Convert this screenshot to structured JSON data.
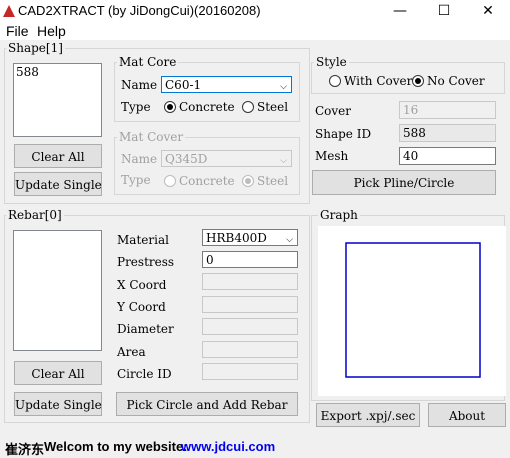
{
  "window": {
    "title": "CAD2XTRACT (by JiDongCui)(20160208)",
    "minimize": "—",
    "maximize": "☐",
    "close": "✕"
  },
  "menu": {
    "file": "File",
    "help": "Help"
  },
  "shape": {
    "group_title": "Shape[1]",
    "list_items": [
      "588"
    ],
    "clear_all": "Clear All",
    "update_single": "Update Single"
  },
  "mat_core": {
    "title": "Mat Core",
    "name_label": "Name",
    "name_value": "C60-1",
    "type_label": "Type",
    "opt_concrete": "Concrete",
    "opt_steel": "Steel",
    "selected": "Concrete"
  },
  "mat_cover": {
    "title": "Mat Cover",
    "name_label": "Name",
    "name_value": "Q345D",
    "type_label": "Type",
    "opt_concrete": "Concrete",
    "opt_steel": "Steel",
    "selected": "Steel"
  },
  "style": {
    "title": "Style",
    "opt_with_cover": "With Cover",
    "opt_no_cover": "No Cover",
    "selected": "No Cover"
  },
  "props": {
    "cover_label": "Cover",
    "cover_value": "16",
    "shape_id_label": "Shape ID",
    "shape_id_value": "588",
    "mesh_label": "Mesh",
    "mesh_value": "40",
    "pick_button": "Pick Pline/Circle"
  },
  "rebar": {
    "group_title": "Rebar[0]",
    "clear_all": "Clear All",
    "update_single": "Update Single",
    "material_label": "Material",
    "material_value": "HRB400D",
    "prestress_label": "Prestress",
    "prestress_value": "0",
    "xcoord_label": "X Coord",
    "ycoord_label": "Y Coord",
    "diameter_label": "Diameter",
    "area_label": "Area",
    "circle_id_label": "Circle ID",
    "pick_add": "Pick Circle and Add Rebar"
  },
  "graph": {
    "title": "Graph",
    "shape_color": "#0000cc"
  },
  "footer": {
    "export": "Export .xpj/.sec",
    "about": "About",
    "status_name": "崔济东",
    "status_text": "Welcom to my website:",
    "status_link": "www.jdcui.com"
  }
}
